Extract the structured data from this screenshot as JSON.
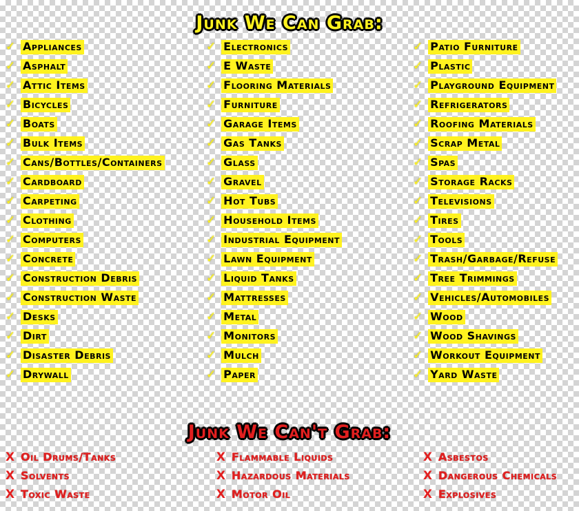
{
  "headings": {
    "can_grab": "Junk We Can Grab:",
    "cannot_grab": "Junk We Can't Grab:"
  },
  "colors": {
    "highlight_yellow": "#fff21f",
    "text_black": "#000000",
    "danger_red": "#e21f1f"
  },
  "marks": {
    "check": "✓",
    "cross": "X"
  },
  "can_grab": {
    "column1": [
      "Appliances",
      "Asphalt",
      "Attic Items",
      "Bicycles",
      "Boats",
      "Bulk Items",
      "Cans/Bottles/Containers",
      "Cardboard",
      "Carpeting",
      "Clothing",
      "Computers",
      "Concrete",
      "Construction Debris",
      "Construction Waste",
      "Desks",
      "Dirt",
      "Disaster Debris",
      "Drywall"
    ],
    "column2": [
      "Electronics",
      "E Waste",
      "Flooring Materials",
      "Furniture",
      "Garage Items",
      "Gas Tanks",
      "Glass",
      "Gravel",
      "Hot Tubs",
      "Household Items",
      "Industrial Equipment",
      "Lawn Equipment",
      "Liquid Tanks",
      "Mattresses",
      "Metal",
      "Monitors",
      "Mulch",
      "Paper"
    ],
    "column3": [
      "Patio Furniture",
      "Plastic",
      "Playground Equipment",
      "Refrigerators",
      "Roofing Materials",
      "Scrap Metal",
      "Spas",
      "Storage Racks",
      "Televisions",
      "Tires",
      "Tools",
      "Trash/Garbage/Refuse",
      "Tree Trimmings",
      "Vehicles/Automobiles",
      "Wood",
      "Wood Shavings",
      "Workout Equipment",
      "Yard Waste"
    ]
  },
  "cannot_grab": {
    "column1": [
      "Oil Drums/Tanks",
      "Solvents",
      "Toxic Waste"
    ],
    "column2": [
      "Flammable Liquids",
      "Hazardous Materials",
      "Motor Oil"
    ],
    "column3": [
      "Asbestos",
      "Dangerous Chemicals",
      "Explosives"
    ]
  }
}
